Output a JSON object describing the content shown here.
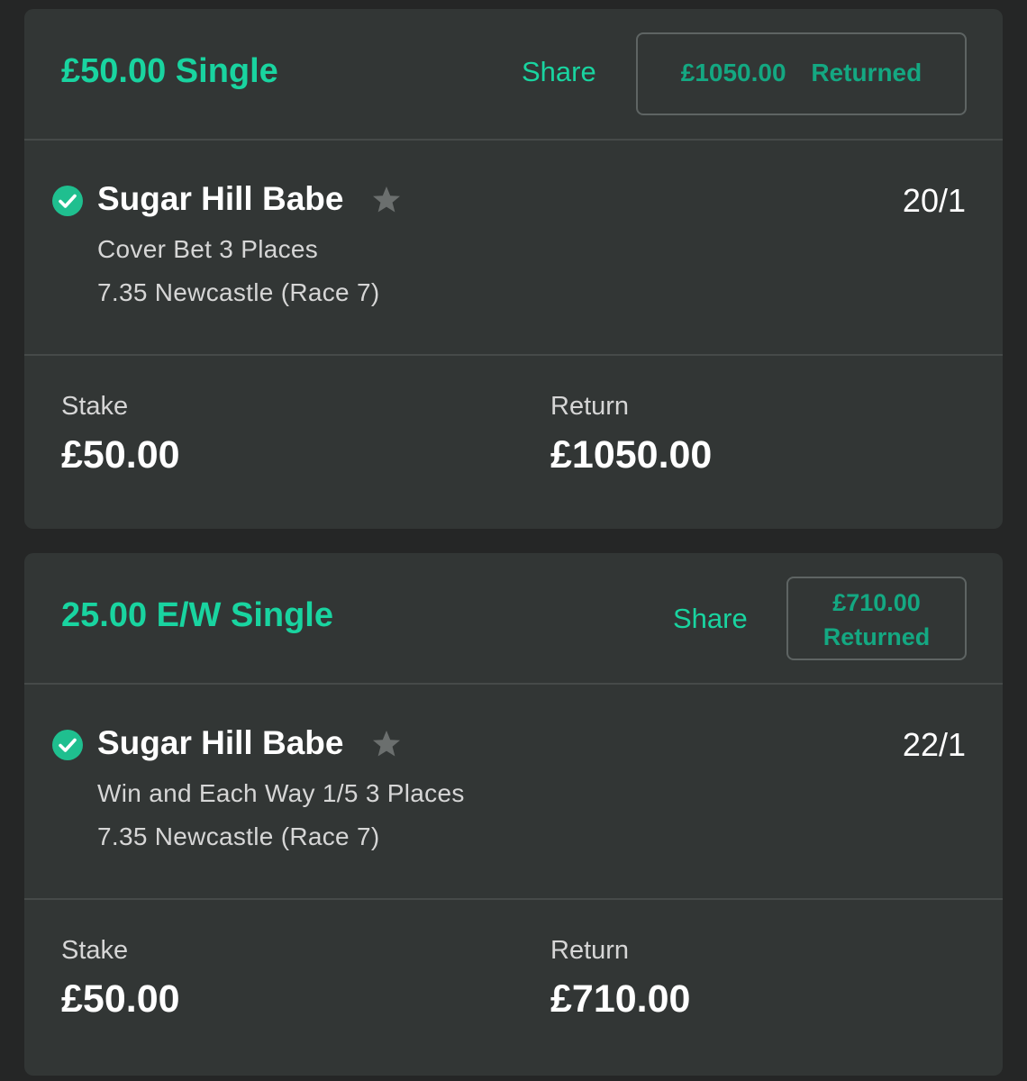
{
  "bets": [
    {
      "title": "£50.00 Single",
      "share_label": "Share",
      "returned_amount": "£1050.00",
      "returned_label": "Returned",
      "runner": "Sugar Hill Babe",
      "odds": "20/1",
      "bet_type": "Cover Bet 3 Places",
      "event": "7.35 Newcastle (Race 7)",
      "stake_label": "Stake",
      "stake_value": "£50.00",
      "return_label": "Return",
      "return_value": "£1050.00",
      "status_icon": "check-circle-icon",
      "favourite_icon": "star-icon"
    },
    {
      "title": "25.00 E/W Single",
      "share_label": "Share",
      "returned_amount": "£710.00",
      "returned_label": "Returned",
      "runner": "Sugar Hill Babe",
      "odds": "22/1",
      "bet_type": "Win and Each Way 1/5 3 Places",
      "event": "7.35 Newcastle (Race 7)",
      "stake_label": "Stake",
      "stake_value": "£50.00",
      "return_label": "Return",
      "return_value": "£710.00",
      "status_icon": "check-circle-icon",
      "favourite_icon": "star-icon"
    }
  ],
  "colors": {
    "background": "#252626",
    "card": "#323635",
    "accent": "#19d4a0",
    "check": "#1fbf8f",
    "star": "#6b6f6e"
  }
}
